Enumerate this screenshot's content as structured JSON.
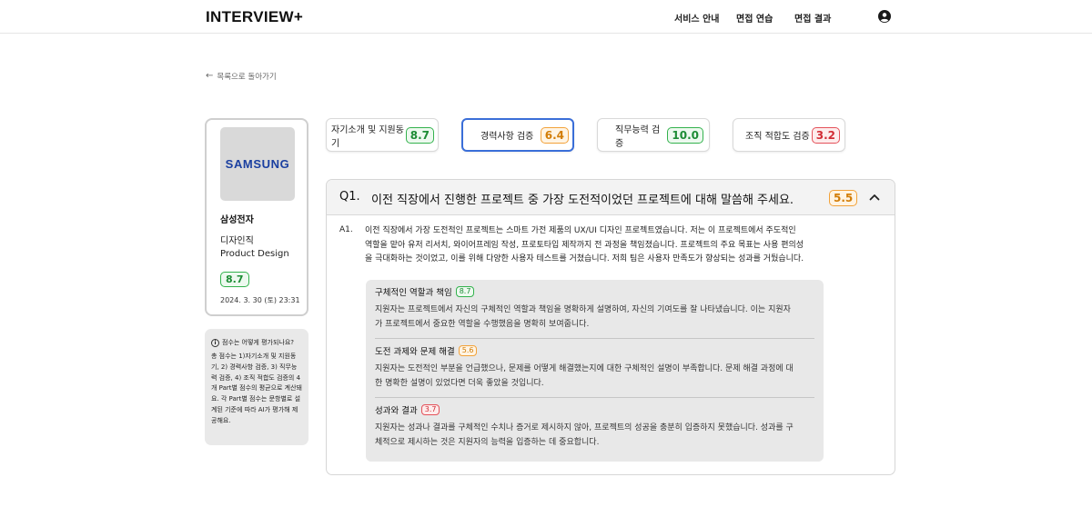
{
  "header": {
    "logo": "INTERVIEW+",
    "nav": [
      "서비스 안내",
      "면접 연습",
      "면접 결과"
    ],
    "user_icon": "user-circle-icon"
  },
  "back_link": {
    "icon": "arrow-left-icon",
    "label": "목록으로 돌아가기"
  },
  "profile": {
    "logo_text": "SAMSUNG",
    "company": "삼성전자",
    "job_category": "디자인직",
    "job_title": "Product Design",
    "total_score": "8.7",
    "date": "2024. 3. 30 (토) 23:31"
  },
  "info": {
    "icon": "info-circle-icon",
    "title": "점수는 어떻게 평가되나요?",
    "text": "총 점수는 1)자기소개 및 지원동기, 2) 경력사항 검증, 3) 직무능력 검증, 4) 조직 적합도 검증의 4개 Part별 점수의 평균으로 계산돼요. 각 Part별 점수는 문항별로 설계된 기준에 따라 AI가 평가해 제공해요."
  },
  "tabs": [
    {
      "label": "자기소개 및 지원동기",
      "score": "8.7",
      "status_color": "#33b24d"
    },
    {
      "label": "경력사항 검증",
      "score": "6.4",
      "status_color": "#f2a23a"
    },
    {
      "label": "직무능력 검증",
      "score": "10.0",
      "status_color": "#33b24d"
    },
    {
      "label": "조직 적합도 검증",
      "score": "3.2",
      "status_color": "#e4515a"
    }
  ],
  "accent_color": "#3a6ed8",
  "question": {
    "number": "Q1.",
    "title": "이전 직장에서 진행한 프로젝트 중 가장 도전적이었던 프로젝트에 대해 말씀해 주세요.",
    "score": "5.5",
    "toggle_icon": "chevron-up-icon",
    "answer_number": "A1.",
    "answer_lines": [
      "이전 직장에서 가장 도전적인 프로젝트는 스마트 가전 제품의 UX/UI 디자인 프로젝트였습니다. 저는 이 프로젝트에서 주도적인",
      "역할을 맡아 유저 리서치, 와이어프레임 작성, 프로토타입 제작까지 전 과정을 책임졌습니다. 프로젝트의 주요 목표는 사용 편의성",
      "을 극대화하는 것이었고, 이를 위해 다양한 사용자 테스트를 거쳤습니다. 저희 팀은 사용자 만족도가 향상되는 성과를 거뒀습니다."
    ],
    "evaluations": [
      {
        "title": "구체적인 역할과 책임",
        "score": "8.7",
        "lines": [
          "지원자는 프로젝트에서 자신의 구체적인 역할과 책임을 명확하게 설명하여, 자신의 기여도를 잘 나타냈습니다. 이는 지원자",
          "가 프로젝트에서 중요한 역할을 수행했음을 명확히 보여줍니다."
        ]
      },
      {
        "title": "도전 과제와 문제 해결",
        "score": "5.6",
        "lines": [
          "지원자는 도전적인 부분을 언급했으나, 문제를 어떻게 해결했는지에 대한 구체적인 설명이 부족합니다. 문제 해결 과정에 대",
          "한 명확한 설명이 있었다면 더욱 좋았을 것입니다."
        ]
      },
      {
        "title": "성과와 결과",
        "score": "3.7",
        "lines": [
          "지원자는 성과나 결과를 구체적인 수치나 증거로 제시하지 않아, 프로젝트의 성공을 충분히 입증하지 못했습니다. 성과를 구",
          "체적으로 제시하는 것은 지원자의 능력을 입증하는 데 중요합니다."
        ]
      }
    ]
  }
}
